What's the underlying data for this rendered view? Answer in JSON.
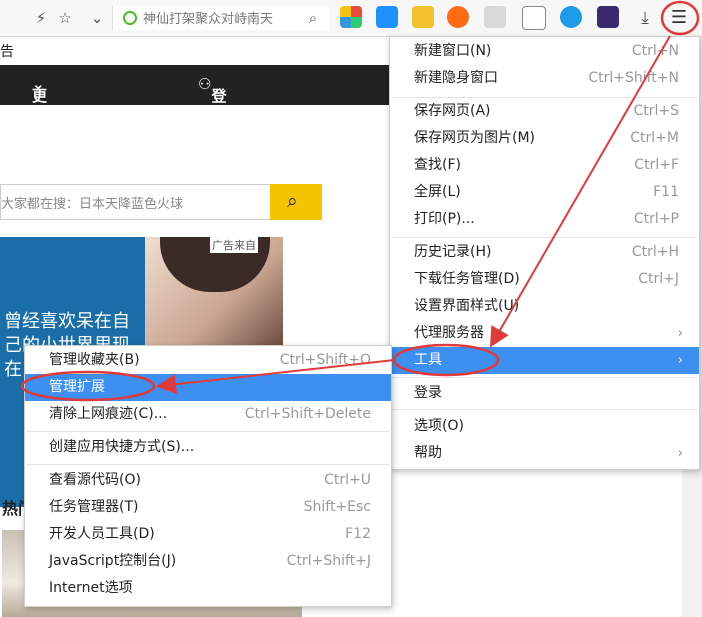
{
  "toolbar": {
    "address_text": "神仙打架聚众对峙南天",
    "lightning_icon": "lightning-icon",
    "star_icon": "star-icon"
  },
  "page": {
    "sub_text": "告",
    "nav_more": "更多",
    "login_link": "登录狐友",
    "search_placeholder": "大家都在搜：日本天降蓝色火球",
    "ad_label": "广告来自",
    "ad_text": "曾经喜欢呆在自己的小世界里现在...",
    "hot_text": "热门"
  },
  "main_menu": {
    "items": [
      {
        "label": "新建窗口(N)",
        "shortcut": "Ctrl+N"
      },
      {
        "label": "新建隐身窗口",
        "shortcut": "Ctrl+Shift+N"
      },
      {
        "label": "保存网页(A)",
        "shortcut": "Ctrl+S"
      },
      {
        "label": "保存网页为图片(M)",
        "shortcut": "Ctrl+M"
      },
      {
        "label": "查找(F)",
        "shortcut": "Ctrl+F"
      },
      {
        "label": "全屏(L)",
        "shortcut": "F11"
      },
      {
        "label": "打印(P)...",
        "shortcut": "Ctrl+P"
      },
      {
        "label": "历史记录(H)",
        "shortcut": "Ctrl+H"
      },
      {
        "label": "下载任务管理(D)",
        "shortcut": "Ctrl+J"
      },
      {
        "label": "设置界面样式(U)",
        "shortcut": ""
      },
      {
        "label": "代理服务器",
        "shortcut": ""
      },
      {
        "label": "工具",
        "shortcut": ""
      },
      {
        "label": "登录",
        "shortcut": ""
      },
      {
        "label": "选项(O)",
        "shortcut": ""
      },
      {
        "label": "帮助",
        "shortcut": ""
      }
    ]
  },
  "tools_submenu": {
    "items": [
      {
        "label": "管理收藏夹(B)",
        "shortcut": "Ctrl+Shift+O"
      },
      {
        "label": "管理扩展",
        "shortcut": ""
      },
      {
        "label": "清除上网痕迹(C)...",
        "shortcut": "Ctrl+Shift+Delete"
      },
      {
        "label": "创建应用快捷方式(S)...",
        "shortcut": ""
      },
      {
        "label": "查看源代码(O)",
        "shortcut": "Ctrl+U"
      },
      {
        "label": "任务管理器(T)",
        "shortcut": "Shift+Esc"
      },
      {
        "label": "开发人员工具(D)",
        "shortcut": "F12"
      },
      {
        "label": "JavaScript控制台(J)",
        "shortcut": "Ctrl+Shift+J"
      },
      {
        "label": "Internet选项",
        "shortcut": ""
      }
    ]
  },
  "colors": {
    "highlight": "#3d8ff0",
    "annotation": "#e03a3a",
    "search_button": "#f5c400"
  }
}
